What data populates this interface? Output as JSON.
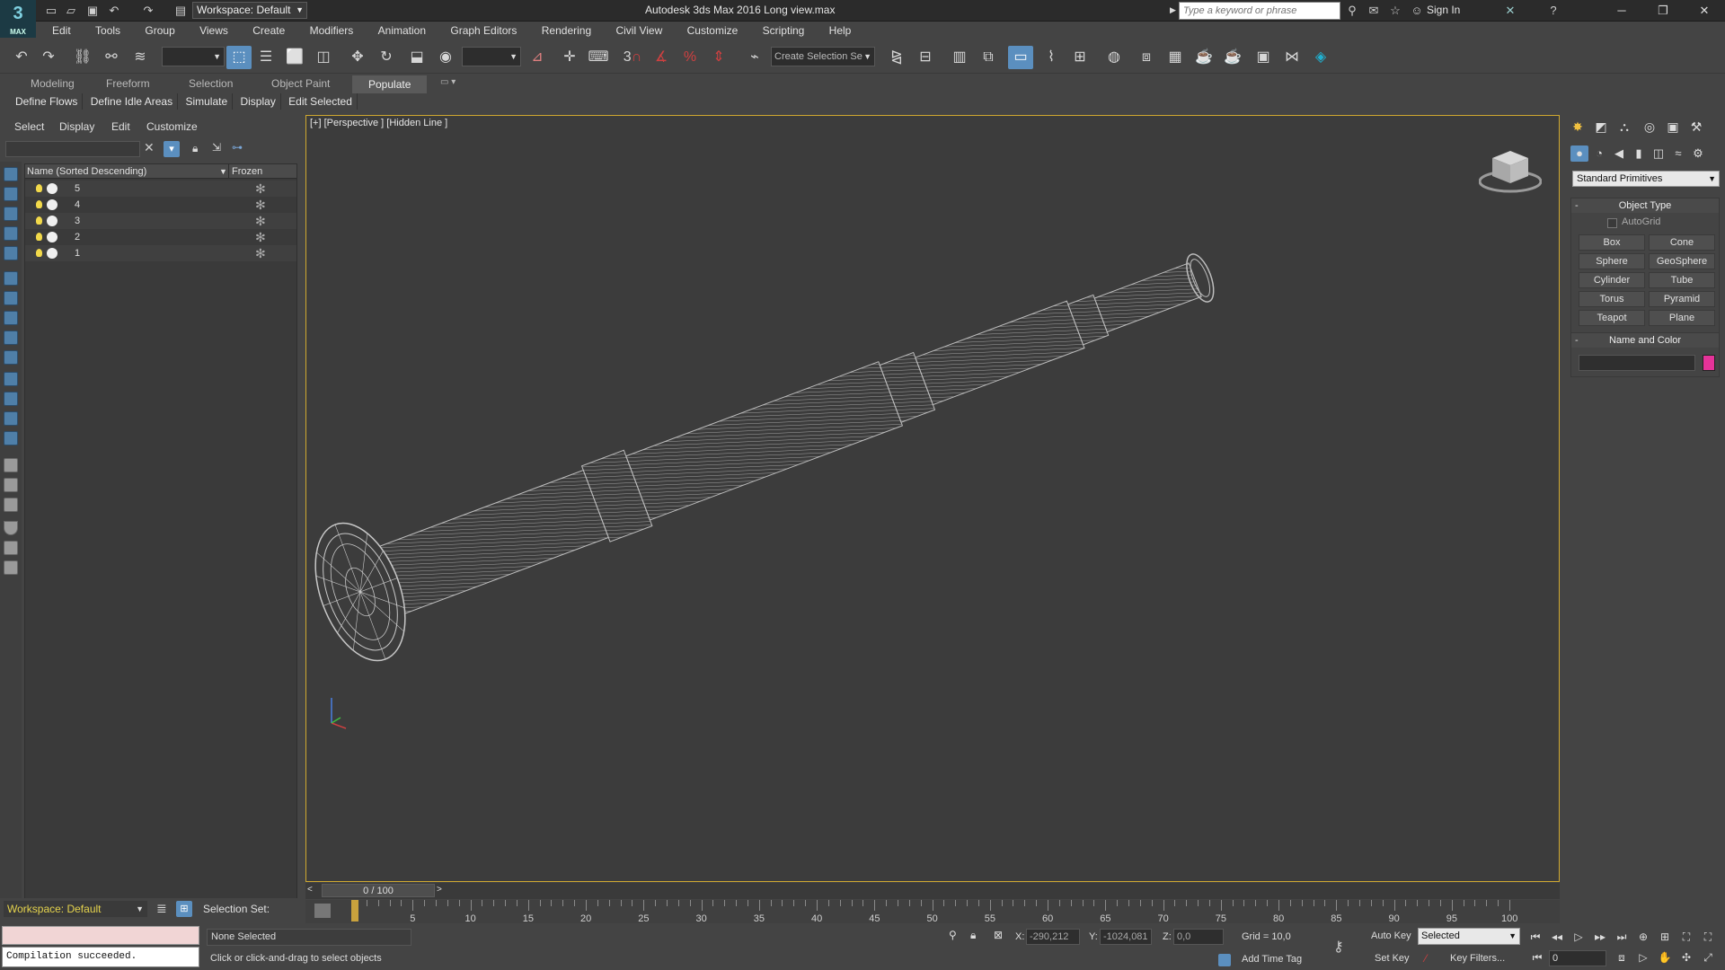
{
  "titlebar": {
    "app_title": "Autodesk 3ds Max 2016     Long view.max",
    "logo": "3",
    "logo_sub": "MAX",
    "workspace": "Workspace: Default",
    "search_placeholder": "Type a keyword or phrase",
    "sign_in": "Sign In"
  },
  "menu": [
    "Edit",
    "Tools",
    "Group",
    "Views",
    "Create",
    "Modifiers",
    "Animation",
    "Graph Editors",
    "Rendering",
    "Civil View",
    "Customize",
    "Scripting",
    "Help"
  ],
  "toolbar": {
    "selection_set_placeholder": "Create Selection Se",
    "snap_3": "3"
  },
  "ribbon": {
    "tabs": [
      "Modeling",
      "Freeform",
      "Selection",
      "Object Paint",
      "Populate"
    ],
    "active_tab": "Populate",
    "sub_items": [
      "Define Flows",
      "Define Idle Areas",
      "Simulate",
      "Display",
      "Edit Selected"
    ]
  },
  "explorer": {
    "menu": [
      "Select",
      "Display",
      "Edit",
      "Customize"
    ],
    "col_name": "Name (Sorted Descending)",
    "col_frozen": "Frozen",
    "rows": [
      "5",
      "4",
      "3",
      "2",
      "1"
    ],
    "workspace": "Workspace: Default",
    "selection_set": "Selection Set:"
  },
  "viewport": {
    "label": "[+] [Perspective ] [Hidden Line ]"
  },
  "timeslider": {
    "position": "0 / 100",
    "ticks": [
      "5",
      "10",
      "15",
      "20",
      "25",
      "30",
      "35",
      "40",
      "45",
      "50",
      "55",
      "60",
      "65",
      "70",
      "75",
      "80",
      "85",
      "90",
      "95",
      "100"
    ]
  },
  "command_panel": {
    "category": "Standard Primitives",
    "object_type_title": "Object Type",
    "autogrid": "AutoGrid",
    "buttons": [
      "Box",
      "Cone",
      "Sphere",
      "GeoSphere",
      "Cylinder",
      "Tube",
      "Torus",
      "Pyramid",
      "Teapot",
      "Plane"
    ],
    "name_color_title": "Name and Color",
    "swatch_color": "#e53399"
  },
  "status": {
    "maxscript_output": "Compilation succeeded.",
    "selection": "None Selected",
    "prompt": "Click or click-and-drag to select objects",
    "x_label": "X:",
    "x_value": "-290,212",
    "y_label": "Y:",
    "y_value": "-1024,081",
    "z_label": "Z:",
    "z_value": "0,0",
    "grid": "Grid = 10,0",
    "add_time_tag": "Add Time Tag",
    "auto_key": "Auto Key",
    "set_key": "Set Key",
    "key_mode": "Selected",
    "key_filters": "Key Filters...",
    "frame": "0"
  },
  "colors": {
    "accent": "#5b8fbf",
    "viewport_border": "#cfa830",
    "workspace_text": "#e5d34d"
  }
}
